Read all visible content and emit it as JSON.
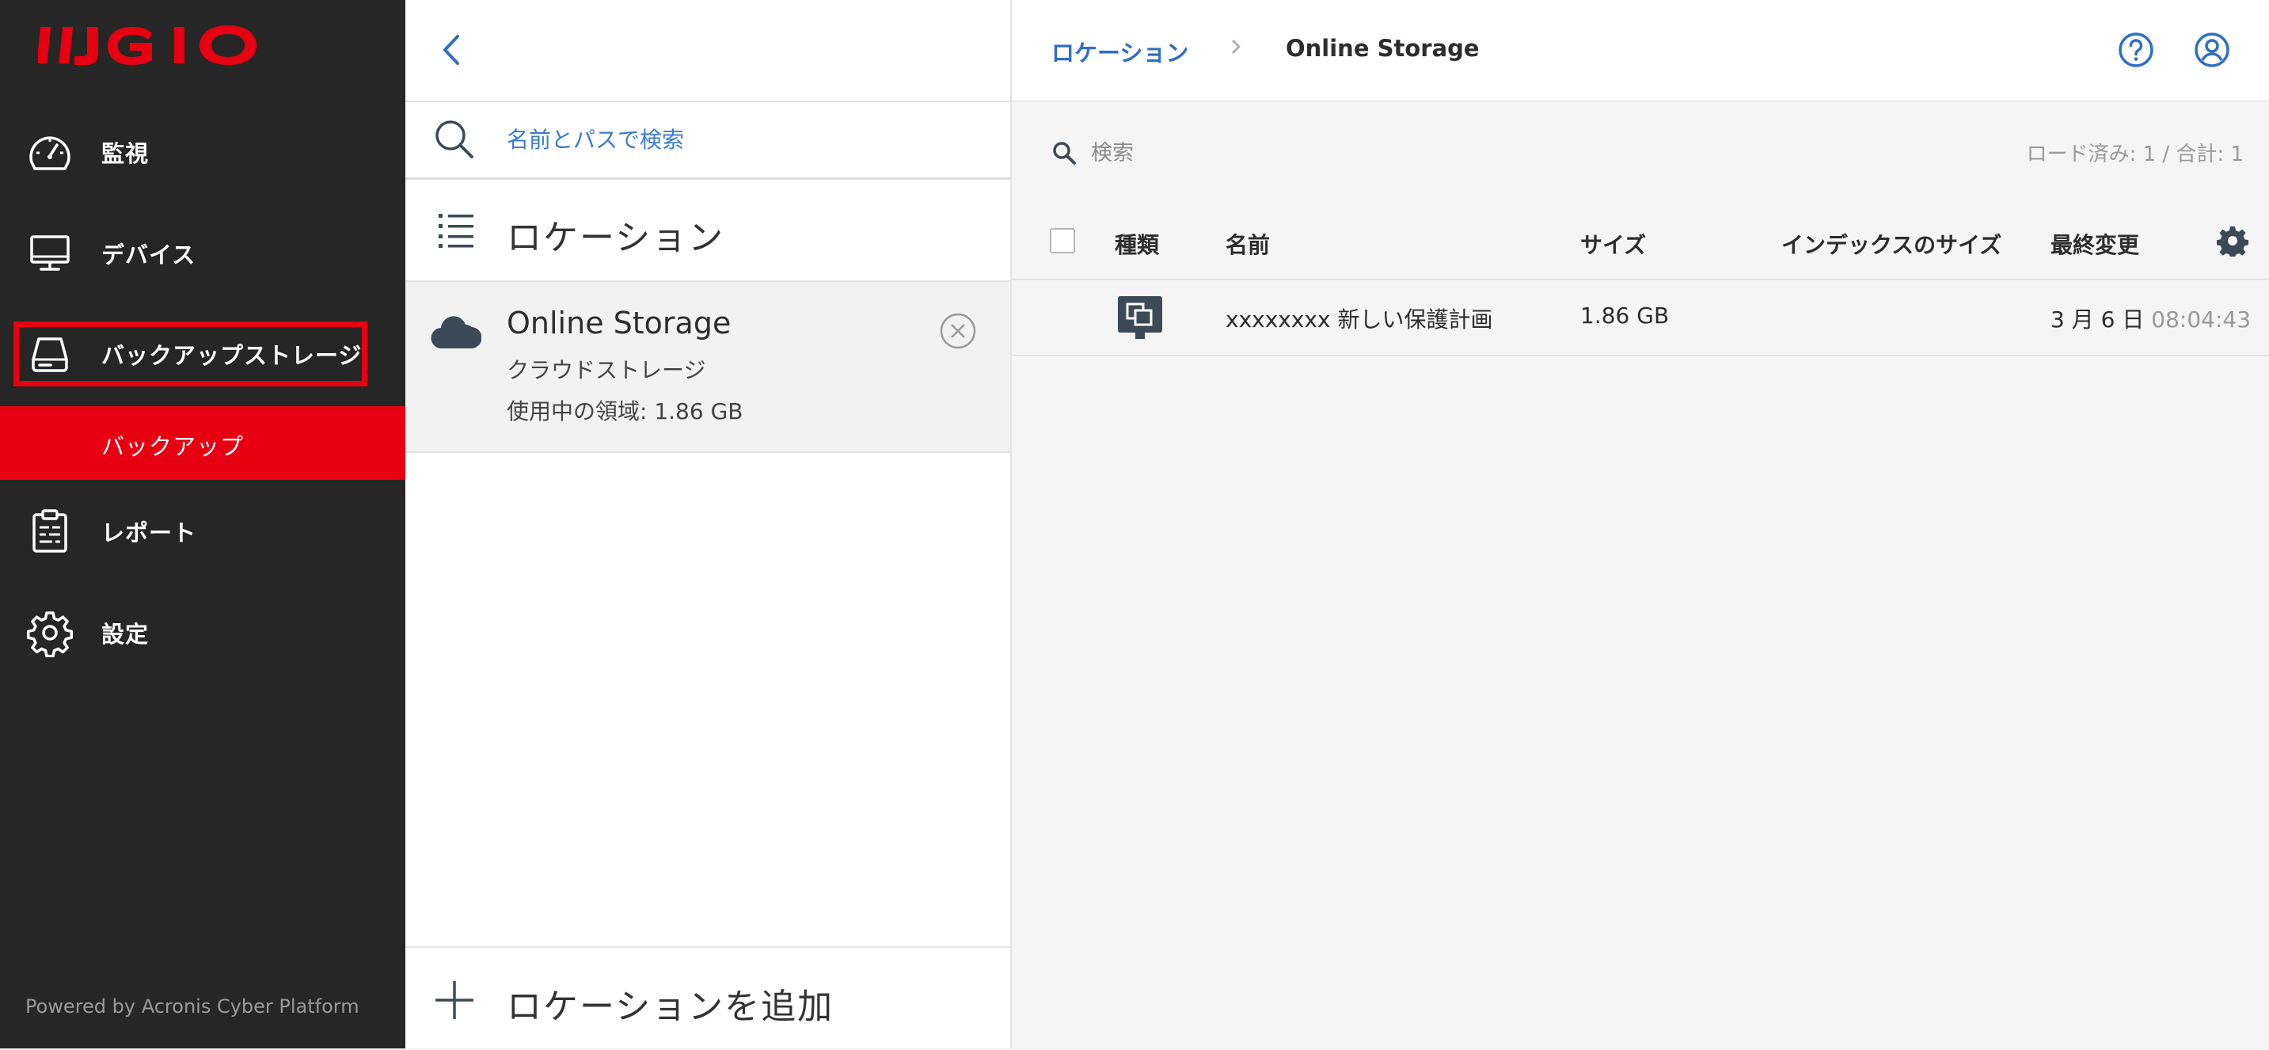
{
  "brand": {
    "logo_text": "IIJ GIO",
    "color": "#e60012"
  },
  "sidebar": {
    "items": [
      {
        "label": "監視",
        "icon": "speedometer-icon"
      },
      {
        "label": "デバイス",
        "icon": "monitor-icon"
      },
      {
        "label": "バックアップストレージ",
        "icon": "hard-drive-icon"
      },
      {
        "label": "バックアップ"
      },
      {
        "label": "レポート",
        "icon": "clipboard-report-icon"
      },
      {
        "label": "設定",
        "icon": "gear-icon"
      }
    ],
    "powered_by": "Powered by Acronis Cyber Platform"
  },
  "middle": {
    "search_placeholder": "名前とパスで検索",
    "heading": "ロケーション",
    "location": {
      "name": "Online Storage",
      "type": "クラウドストレージ",
      "usage": "使用中の領域: 1.86 GB"
    },
    "add_label": "ロケーションを追加"
  },
  "topbar": {
    "breadcrumb_root": "ロケーション",
    "breadcrumb_current": "Online Storage"
  },
  "list": {
    "search_placeholder": "検索",
    "loaded_text": "ロード済み: 1 / 合計: 1",
    "columns": [
      "種類",
      "名前",
      "サイズ",
      "インデックスのサイズ",
      "最終変更"
    ],
    "rows": [
      {
        "type_icon": "backup-machine-icon",
        "name": "xxxxxxxx 新しい保護計画",
        "size": "1.86 GB",
        "index_size": "",
        "modified_date": "3 月 6 日",
        "modified_time": "08:04:43"
      }
    ]
  },
  "colors": {
    "sidebar_bg": "#262626",
    "accent_red": "#e60012",
    "link_blue": "#2f6fc2",
    "icon_gray": "#3c4a58"
  }
}
